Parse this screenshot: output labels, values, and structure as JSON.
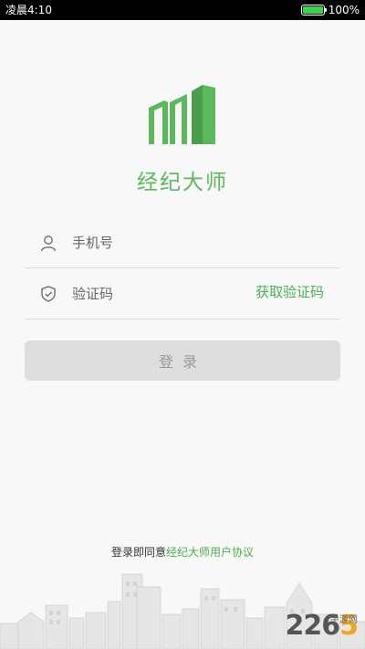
{
  "status_bar": {
    "time": "凌晨4:10",
    "battery_text": "100%",
    "battery_level": 1.0
  },
  "app": {
    "name": "经纪大师",
    "logo_icon": "building-logo-icon",
    "accent_color": "#5cb85c"
  },
  "form": {
    "phone_placeholder": "手机号",
    "phone_icon": "user-icon",
    "code_placeholder": "验证码",
    "code_icon": "shield-icon",
    "get_code_label": "获取验证码",
    "login_label": "登录"
  },
  "agreement": {
    "prefix": "登录即同意",
    "link": "经纪大师用户协议"
  },
  "watermark": {
    "number_a": "226",
    "number_b": "5",
    "site": "手游网"
  }
}
